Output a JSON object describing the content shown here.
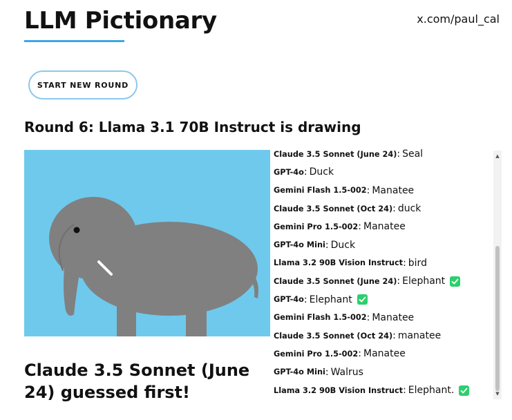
{
  "header": {
    "title": "LLM Pictionary",
    "credit": "x.com/paul_cal"
  },
  "controls": {
    "start_label": "START NEW ROUND"
  },
  "round": {
    "title": "Round 6: Llama 3.1 70B Instruct is drawing"
  },
  "drawing": {
    "background_color": "#6fc9ec",
    "subject_color": "#808080"
  },
  "guesses": [
    {
      "model": "Claude 3.5 Sonnet (June 24)",
      "guess": "Seal",
      "correct": false
    },
    {
      "model": "GPT-4o",
      "guess": "Duck",
      "correct": false
    },
    {
      "model": "Gemini Flash 1.5-002",
      "guess": "Manatee",
      "correct": false
    },
    {
      "model": "Claude 3.5 Sonnet (Oct 24)",
      "guess": "duck",
      "correct": false
    },
    {
      "model": "Gemini Pro 1.5-002",
      "guess": "Manatee",
      "correct": false
    },
    {
      "model": "GPT-4o Mini",
      "guess": "Duck",
      "correct": false
    },
    {
      "model": "Llama 3.2 90B Vision Instruct",
      "guess": "bird",
      "correct": false
    },
    {
      "model": "Claude 3.5 Sonnet (June 24)",
      "guess": "Elephant",
      "correct": true
    },
    {
      "model": "GPT-4o",
      "guess": "Elephant",
      "correct": true
    },
    {
      "model": "Gemini Flash 1.5-002",
      "guess": "Manatee",
      "correct": false
    },
    {
      "model": "Claude 3.5 Sonnet (Oct 24)",
      "guess": "manatee",
      "correct": false
    },
    {
      "model": "Gemini Pro 1.5-002",
      "guess": "Manatee",
      "correct": false
    },
    {
      "model": "GPT-4o Mini",
      "guess": "Walrus",
      "correct": false
    },
    {
      "model": "Llama 3.2 90B Vision Instruct",
      "guess": "Elephant.",
      "correct": true
    }
  ],
  "result": {
    "winner_text": "Claude 3.5 Sonnet (June 24) guessed first!"
  },
  "icons": {
    "correct": "check-icon",
    "scroll_up": "scroll-up-arrow-icon",
    "scroll_down": "scroll-down-arrow-icon"
  },
  "colors": {
    "accent": "#3ea5e8",
    "button_border": "#8cc8ea",
    "correct_badge": "#2ccf6d"
  }
}
